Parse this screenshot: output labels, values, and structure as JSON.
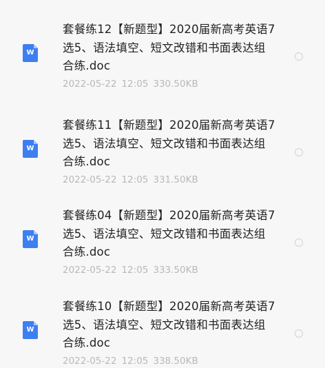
{
  "files": [
    {
      "name": "套餐练12【新题型】2020届新高考英语7选5、语法填空、短文改错和书面表达组合练.doc",
      "date": "2022-05-22",
      "time": "12:05",
      "size": "330.50KB",
      "icon": "word-doc-icon",
      "icon_letter": "W"
    },
    {
      "name": "套餐练11【新题型】2020届新高考英语7选5、语法填空、短文改错和书面表达组合练.doc",
      "date": "2022-05-22",
      "time": "12:05",
      "size": "331.50KB",
      "icon": "word-doc-icon",
      "icon_letter": "W"
    },
    {
      "name": "套餐练04【新题型】2020届新高考英语7选5、语法填空、短文改错和书面表达组合练.doc",
      "date": "2022-05-22",
      "time": "12:05",
      "size": "333.50KB",
      "icon": "word-doc-icon",
      "icon_letter": "W"
    },
    {
      "name": "套餐练10【新题型】2020届新高考英语7选5、语法填空、短文改错和书面表达组合练.doc",
      "date": "2022-05-22",
      "time": "12:05",
      "size": "338.50KB",
      "icon": "word-doc-icon",
      "icon_letter": "W"
    }
  ],
  "colors": {
    "background": "#f7f7f7",
    "icon_blue": "#3d7ff0",
    "title_text": "#222222",
    "meta_text": "#b9b9b9",
    "radio_border": "#d2d2d2"
  }
}
